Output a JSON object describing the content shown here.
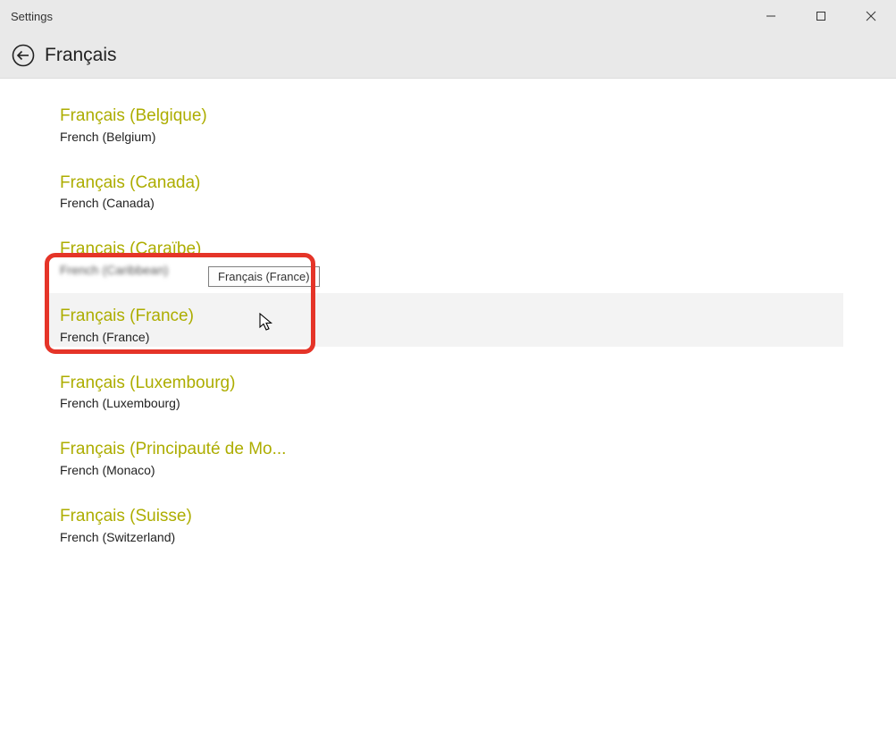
{
  "window": {
    "title": "Settings"
  },
  "header": {
    "title": "Français"
  },
  "accent_color": "#adad00",
  "highlight_border_color": "#e53428",
  "tooltip_text": "Français (France)",
  "languages": [
    {
      "native": "Français (Belgique)",
      "english": "French (Belgium)"
    },
    {
      "native": "Français (Canada)",
      "english": "French (Canada)"
    },
    {
      "native": "Français (Caraïbe)",
      "english": "French (Caribbean)"
    },
    {
      "native": "Français (France)",
      "english": "French (France)"
    },
    {
      "native": "Français (Luxembourg)",
      "english": "French (Luxembourg)"
    },
    {
      "native": "Français (Principauté de Mo...",
      "english": "French (Monaco)"
    },
    {
      "native": "Français (Suisse)",
      "english": "French (Switzerland)"
    }
  ]
}
